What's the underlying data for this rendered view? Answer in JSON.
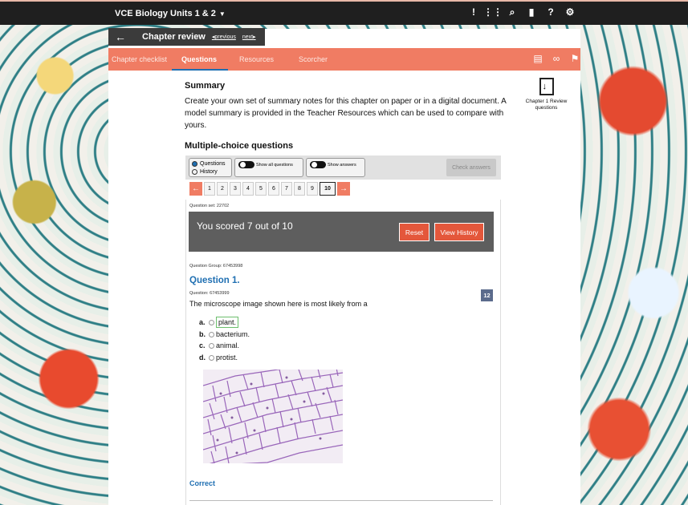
{
  "topbar": {
    "title": "VCE Biology Units 1 & 2",
    "icons": [
      "feedback-icon",
      "apps-grid-icon",
      "search-icon",
      "bookmarks-icon",
      "help-icon",
      "settings-icon"
    ]
  },
  "subbar": {
    "title": "Chapter review",
    "previous": "previous",
    "next": "next"
  },
  "tabs": [
    {
      "label": "Chapter checklist",
      "active": false
    },
    {
      "label": "Questions",
      "active": true
    },
    {
      "label": "Resources",
      "active": false
    },
    {
      "label": "Scorcher",
      "active": false
    }
  ],
  "summary": {
    "heading": "Summary",
    "text": "Create your own set of summary notes for this chapter on paper or in a digital document. A model summary is provided in the Teacher Resources which can be used to compare with yours."
  },
  "download": {
    "label": "Chapter 1 Review questions"
  },
  "mcq": {
    "heading": "Multiple-choice questions",
    "mode_questions": "Questions",
    "mode_history": "History",
    "show_all": "Show all questions",
    "show_answers": "Show answers",
    "check_answers": "Check answers"
  },
  "pager": {
    "pages": [
      "1",
      "2",
      "3",
      "4",
      "5",
      "6",
      "7",
      "8",
      "9",
      "10"
    ],
    "current": "10"
  },
  "result": {
    "question_set": "Question set: 22702",
    "score_text": "You scored 7 out of 10",
    "reset": "Reset",
    "view_history": "View History"
  },
  "question": {
    "group": "Question Group: 67453998",
    "title": "Question 1.",
    "id": "Question: 67453999",
    "badge": "12",
    "text": "The microscope image shown here is most likely from a",
    "options": [
      {
        "key": "a.",
        "text": "plant.",
        "selected": true
      },
      {
        "key": "b.",
        "text": "bacterium.",
        "selected": false
      },
      {
        "key": "c.",
        "text": "animal.",
        "selected": false
      },
      {
        "key": "d.",
        "text": "protist.",
        "selected": false
      }
    ],
    "feedback": "Correct"
  },
  "colors": {
    "accent": "#f07c63",
    "link": "#1f6fb2",
    "topbar": "#1f1f1f",
    "score_panel": "#5e5e5e",
    "button": "#e4573b"
  }
}
